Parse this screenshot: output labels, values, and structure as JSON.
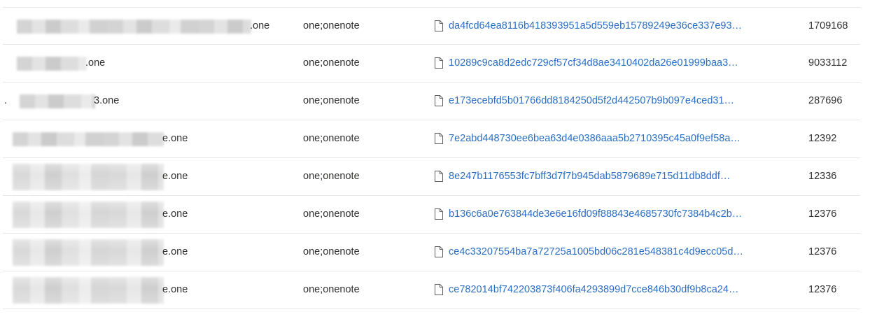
{
  "rows": [
    {
      "name_suffix": ".one",
      "type": "one;onenote",
      "file": "da4fcd64ea8116b418393951a5d559eb15789249e36ce337e93…",
      "size": "1709168",
      "file_icon": "document-icon"
    },
    {
      "name_suffix": ".one",
      "type": "one;onenote",
      "file": "10289c9ca8d2edc729cf57cf34d8ae3410402da26e01999baa3…",
      "size": "9033112",
      "file_icon": "document-icon"
    },
    {
      "name_prefix": ".",
      "name_suffix": "3.one",
      "type": "one;onenote",
      "file": "e173ecebfd5b01766dd8184250d5f2d442507b9b097e4ced31…",
      "size": "287696",
      "file_icon": "document-icon"
    },
    {
      "name_suffix": "e.one",
      "type": "one;onenote",
      "file": "7e2abd448730ee6bea63d4e0386aaa5b2710395c45a0f9ef58a…",
      "size": "12392",
      "file_icon": "document-icon"
    },
    {
      "name_suffix": "e.one",
      "type": "one;onenote",
      "file": "8e247b1176553fc7bff3d7f7b945dab5879689e715d11db8ddf…",
      "size": "12336",
      "file_icon": "document-icon"
    },
    {
      "name_suffix": "e.one",
      "type": "one;onenote",
      "file": "b136c6a0e763844de3e6e16fd09f88843e4685730fc7384b4c2b…",
      "size": "12376",
      "file_icon": "document-icon"
    },
    {
      "name_suffix": "e.one",
      "type": "one;onenote",
      "file": "ce4c33207554ba7a72725a1005bd06c281e548381c4d9ecc05d…",
      "size": "12376",
      "file_icon": "document-icon"
    },
    {
      "name_suffix": "e.one",
      "type": "one;onenote",
      "file": "ce782014bf742203873f406fa4293899d7cce846b30df9b8ca24…",
      "size": "12376",
      "file_icon": "document-icon"
    }
  ],
  "colors": {
    "link": "#2b6fc4",
    "text": "#323130",
    "divider": "#e8e8e8"
  }
}
